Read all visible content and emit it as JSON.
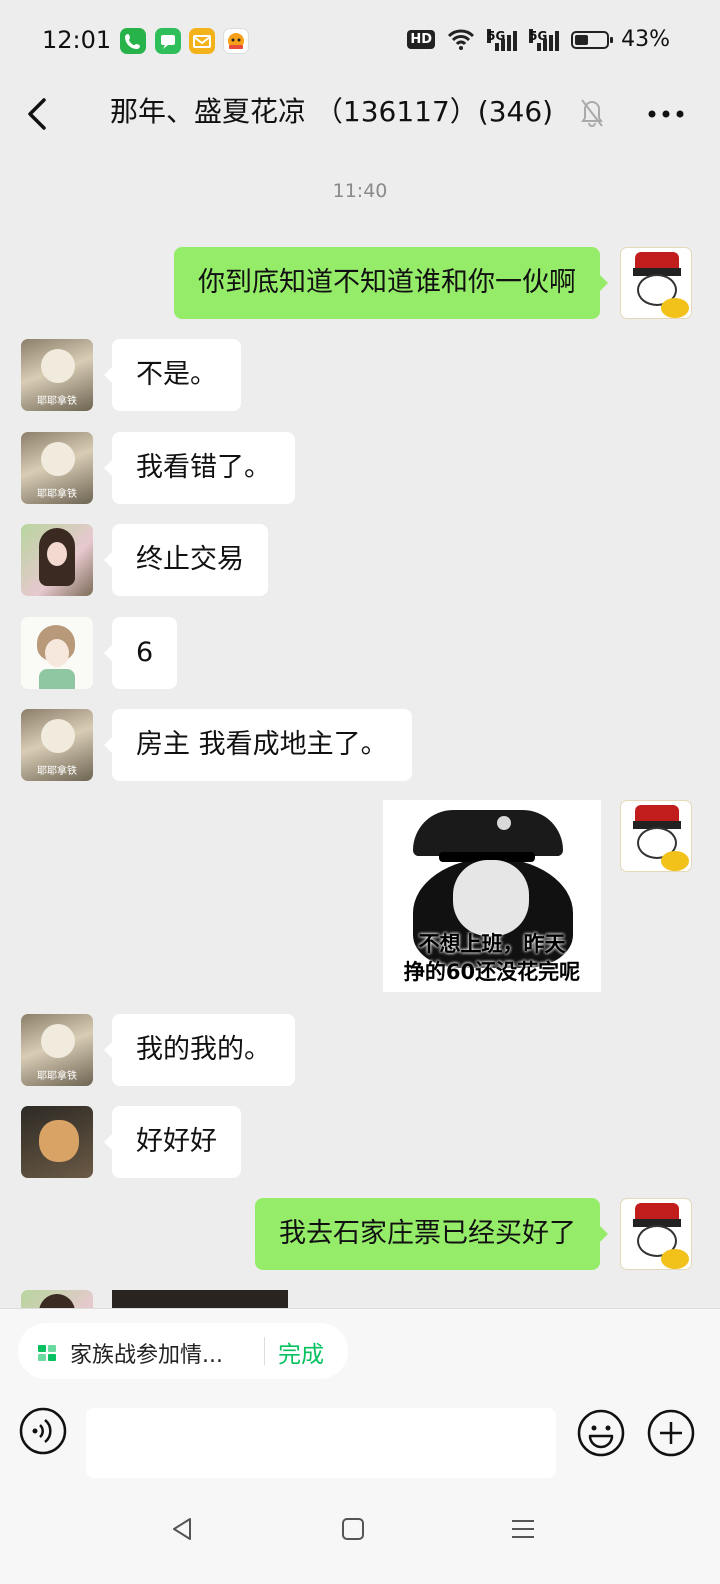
{
  "status_bar": {
    "time": "12:01",
    "hd_label": "HD",
    "network_1": "5G",
    "network_2": "5G",
    "battery_percent": "43%",
    "battery_level": 0.43,
    "app_icons": [
      "phone-app-icon",
      "messages-app-icon",
      "mail-app-icon",
      "game-app-icon"
    ]
  },
  "header": {
    "title": "那年、盛夏花凉 （136117）(346)",
    "back_icon": "chevron-left-icon",
    "mute_icon": "bell-off-icon",
    "more_icon": "more-dots-icon"
  },
  "chat": {
    "timestamp": "11:40",
    "messages": [
      {
        "side": "out",
        "avatar": "self-avatar",
        "text": "你到底知道不知道谁和你一伙啊"
      },
      {
        "side": "in",
        "avatar": "dog-avatar",
        "avatar_tag": "耶耶拿铁",
        "text": "不是。"
      },
      {
        "side": "in",
        "avatar": "dog-avatar",
        "avatar_tag": "耶耶拿铁",
        "text": "我看错了。"
      },
      {
        "side": "in",
        "avatar": "girl-avatar",
        "text": "终止交易"
      },
      {
        "side": "in",
        "avatar": "sketch-avatar",
        "text": "6"
      },
      {
        "side": "in",
        "avatar": "dog-avatar",
        "avatar_tag": "耶耶拿铁",
        "text": "房主 我看成地主了。"
      },
      {
        "side": "out",
        "avatar": "self-avatar",
        "type": "sticker",
        "sticker_text_1": "不想上班，昨天",
        "sticker_text_2": "挣的60还没花完呢"
      },
      {
        "side": "in",
        "avatar": "dog-avatar",
        "avatar_tag": "耶耶拿铁",
        "text": "我的我的。"
      },
      {
        "side": "in",
        "avatar": "cat-avatar",
        "text": "好好好"
      },
      {
        "side": "out",
        "avatar": "self-avatar",
        "text": "我去石家庄票已经买好了"
      }
    ]
  },
  "quick_bar": {
    "pill_label": "家族战参加情...",
    "pill_action": "完成",
    "accent": "#07c160"
  },
  "colors": {
    "outgoing_bubble": "#95ec69",
    "incoming_bubble": "#ffffff",
    "background": "#ededed"
  }
}
